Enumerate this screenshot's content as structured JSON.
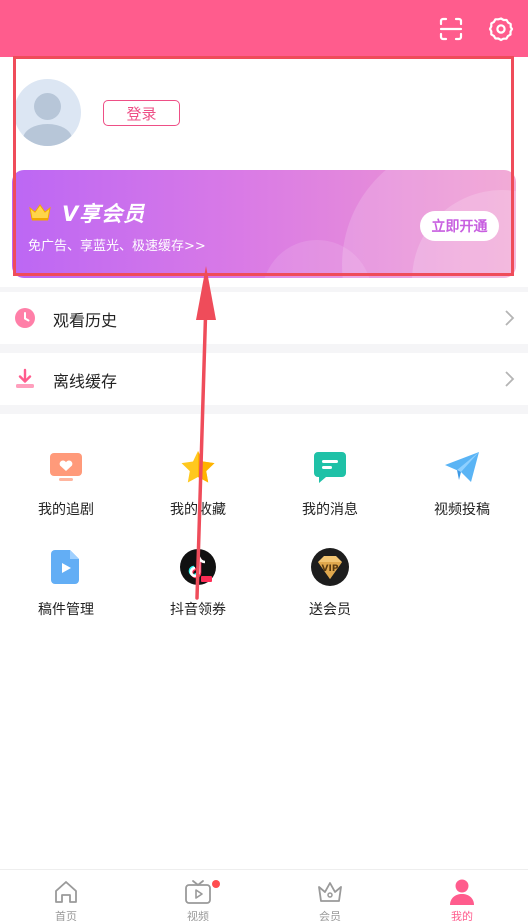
{
  "colors": {
    "brand": "#ff5c8d",
    "annotation": "#ef4c5a",
    "vip_gradient_start": "#bc67f4",
    "vip_gradient_end": "#f09bcf"
  },
  "header": {
    "icons": [
      "scan-icon",
      "gear-icon"
    ]
  },
  "profile": {
    "login_label": "登录",
    "avatar_icon": "default-avatar-icon"
  },
  "vip_card": {
    "title": "V享会员",
    "subtitle": "免广告、享蓝光、极速缓存>>",
    "button": "立即开通",
    "icon": "crown-icon"
  },
  "menu": [
    {
      "label": "观看历史",
      "icon": "clock-icon"
    },
    {
      "label": "离线缓存",
      "icon": "download-icon"
    }
  ],
  "grid": [
    {
      "label": "我的追剧",
      "icon": "tv-heart-icon"
    },
    {
      "label": "我的收藏",
      "icon": "star-icon"
    },
    {
      "label": "我的消息",
      "icon": "message-icon"
    },
    {
      "label": "视频投稿",
      "icon": "paper-plane-icon"
    },
    {
      "label": "稿件管理",
      "icon": "video-file-icon"
    },
    {
      "label": "抖音领券",
      "icon": "tiktok-icon"
    },
    {
      "label": "送会员",
      "icon": "vip-badge-icon"
    }
  ],
  "tabbar": [
    {
      "label": "首页",
      "icon": "home-icon",
      "active": false
    },
    {
      "label": "视频",
      "icon": "tv-icon",
      "active": false,
      "badge": true
    },
    {
      "label": "会员",
      "icon": "crown-outline-icon",
      "active": false
    },
    {
      "label": "我的",
      "icon": "user-icon",
      "active": true
    }
  ]
}
